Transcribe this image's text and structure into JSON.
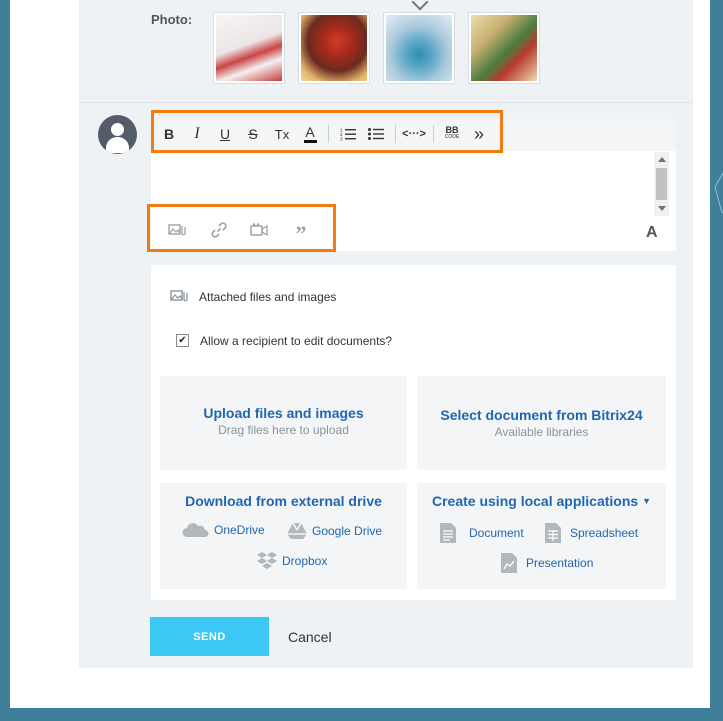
{
  "post": {
    "photo_label": "Photo:",
    "photos": [
      {
        "name": "photo-teacup-candy-cane",
        "colors": [
          "#f5f2f2",
          "#c73b3b"
        ]
      },
      {
        "name": "photo-red-gnome",
        "colors": [
          "#8a2a1c",
          "#f0c27a"
        ]
      },
      {
        "name": "photo-snow-house",
        "colors": [
          "#8fb7d1",
          "#e9f1f7"
        ]
      },
      {
        "name": "photo-tree-gnomes",
        "colors": [
          "#4b7a3e",
          "#e6d8a5"
        ]
      }
    ]
  },
  "editor": {
    "toolbar": {
      "bold": "B",
      "italic": "I",
      "underline": "U",
      "strike": "S",
      "clear_format": "Tx",
      "font_color": "A",
      "numbered_list": "numbered-list-icon",
      "bullet_list": "bullet-list-icon",
      "code": "<···>",
      "bbcode_top": "BB",
      "bbcode_bottom": "CODE",
      "more": "»"
    },
    "insert_bar": [
      "attach-image-icon",
      "link-icon",
      "video-icon",
      "quote-icon"
    ],
    "font_toggle": "A"
  },
  "attachments": {
    "title": "Attached files and images",
    "allow_edit_label": "Allow a recipient to edit documents?",
    "allow_edit_checked": true,
    "upload": {
      "title": "Upload files and images",
      "subtitle": "Drag files here to upload"
    },
    "bitrix": {
      "title": "Select document from Bitrix24",
      "subtitle": "Available libraries"
    },
    "external": {
      "title": "Download from external drive",
      "onedrive": "OneDrive",
      "google_drive": "Google Drive",
      "dropbox": "Dropbox"
    },
    "local": {
      "title": "Create using local applications",
      "document": "Document",
      "spreadsheet": "Spreadsheet",
      "presentation": "Presentation"
    }
  },
  "actions": {
    "send": "SEND",
    "cancel": "Cancel"
  },
  "colors": {
    "highlight": "#f27b12",
    "send": "#3bc8f5",
    "link": "#2067b0"
  }
}
